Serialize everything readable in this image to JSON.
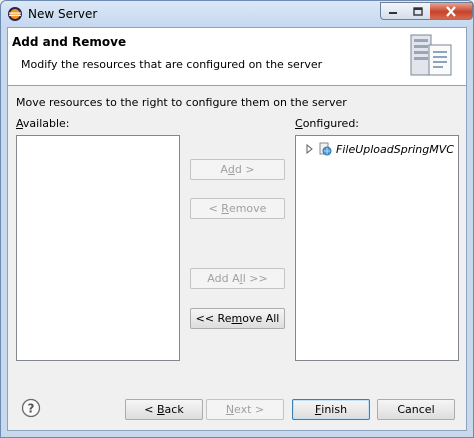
{
  "window": {
    "title": "New Server"
  },
  "header": {
    "title": "Add and Remove",
    "description": "Modify the resources that are configured on the server"
  },
  "instruction": "Move resources to the right to configure them on the server",
  "available": {
    "label_pre": "",
    "label_mnemonic": "A",
    "label_post": "vailable:",
    "items": []
  },
  "configured": {
    "label_pre": "",
    "label_mnemonic": "C",
    "label_post": "onfigured:",
    "items": [
      {
        "label": "FileUploadSpringMVC"
      }
    ]
  },
  "buttons": {
    "add": {
      "pre": "A",
      "mn": "d",
      "post": "d >",
      "enabled": false
    },
    "remove": {
      "pre": "< ",
      "mn": "R",
      "post": "emove",
      "enabled": false
    },
    "add_all": {
      "pre": "Add A",
      "mn": "l",
      "post": "l >>",
      "enabled": false
    },
    "remove_all": {
      "pre": "<< Re",
      "mn": "m",
      "post": "ove All",
      "enabled": true
    },
    "back": {
      "pre": "< ",
      "mn": "B",
      "post": "ack",
      "enabled": true
    },
    "next": {
      "pre": "",
      "mn": "N",
      "post": "ext >",
      "enabled": false
    },
    "finish": {
      "pre": "",
      "mn": "F",
      "post": "inish",
      "enabled": true
    },
    "cancel": {
      "pre": "Cancel",
      "mn": "",
      "post": "",
      "enabled": true
    }
  },
  "icons": {
    "app": "eclipse-icon",
    "header": "server-wizard-icon",
    "help": "help-icon",
    "project": "web-project-icon",
    "expand": "tree-expand-icon"
  }
}
